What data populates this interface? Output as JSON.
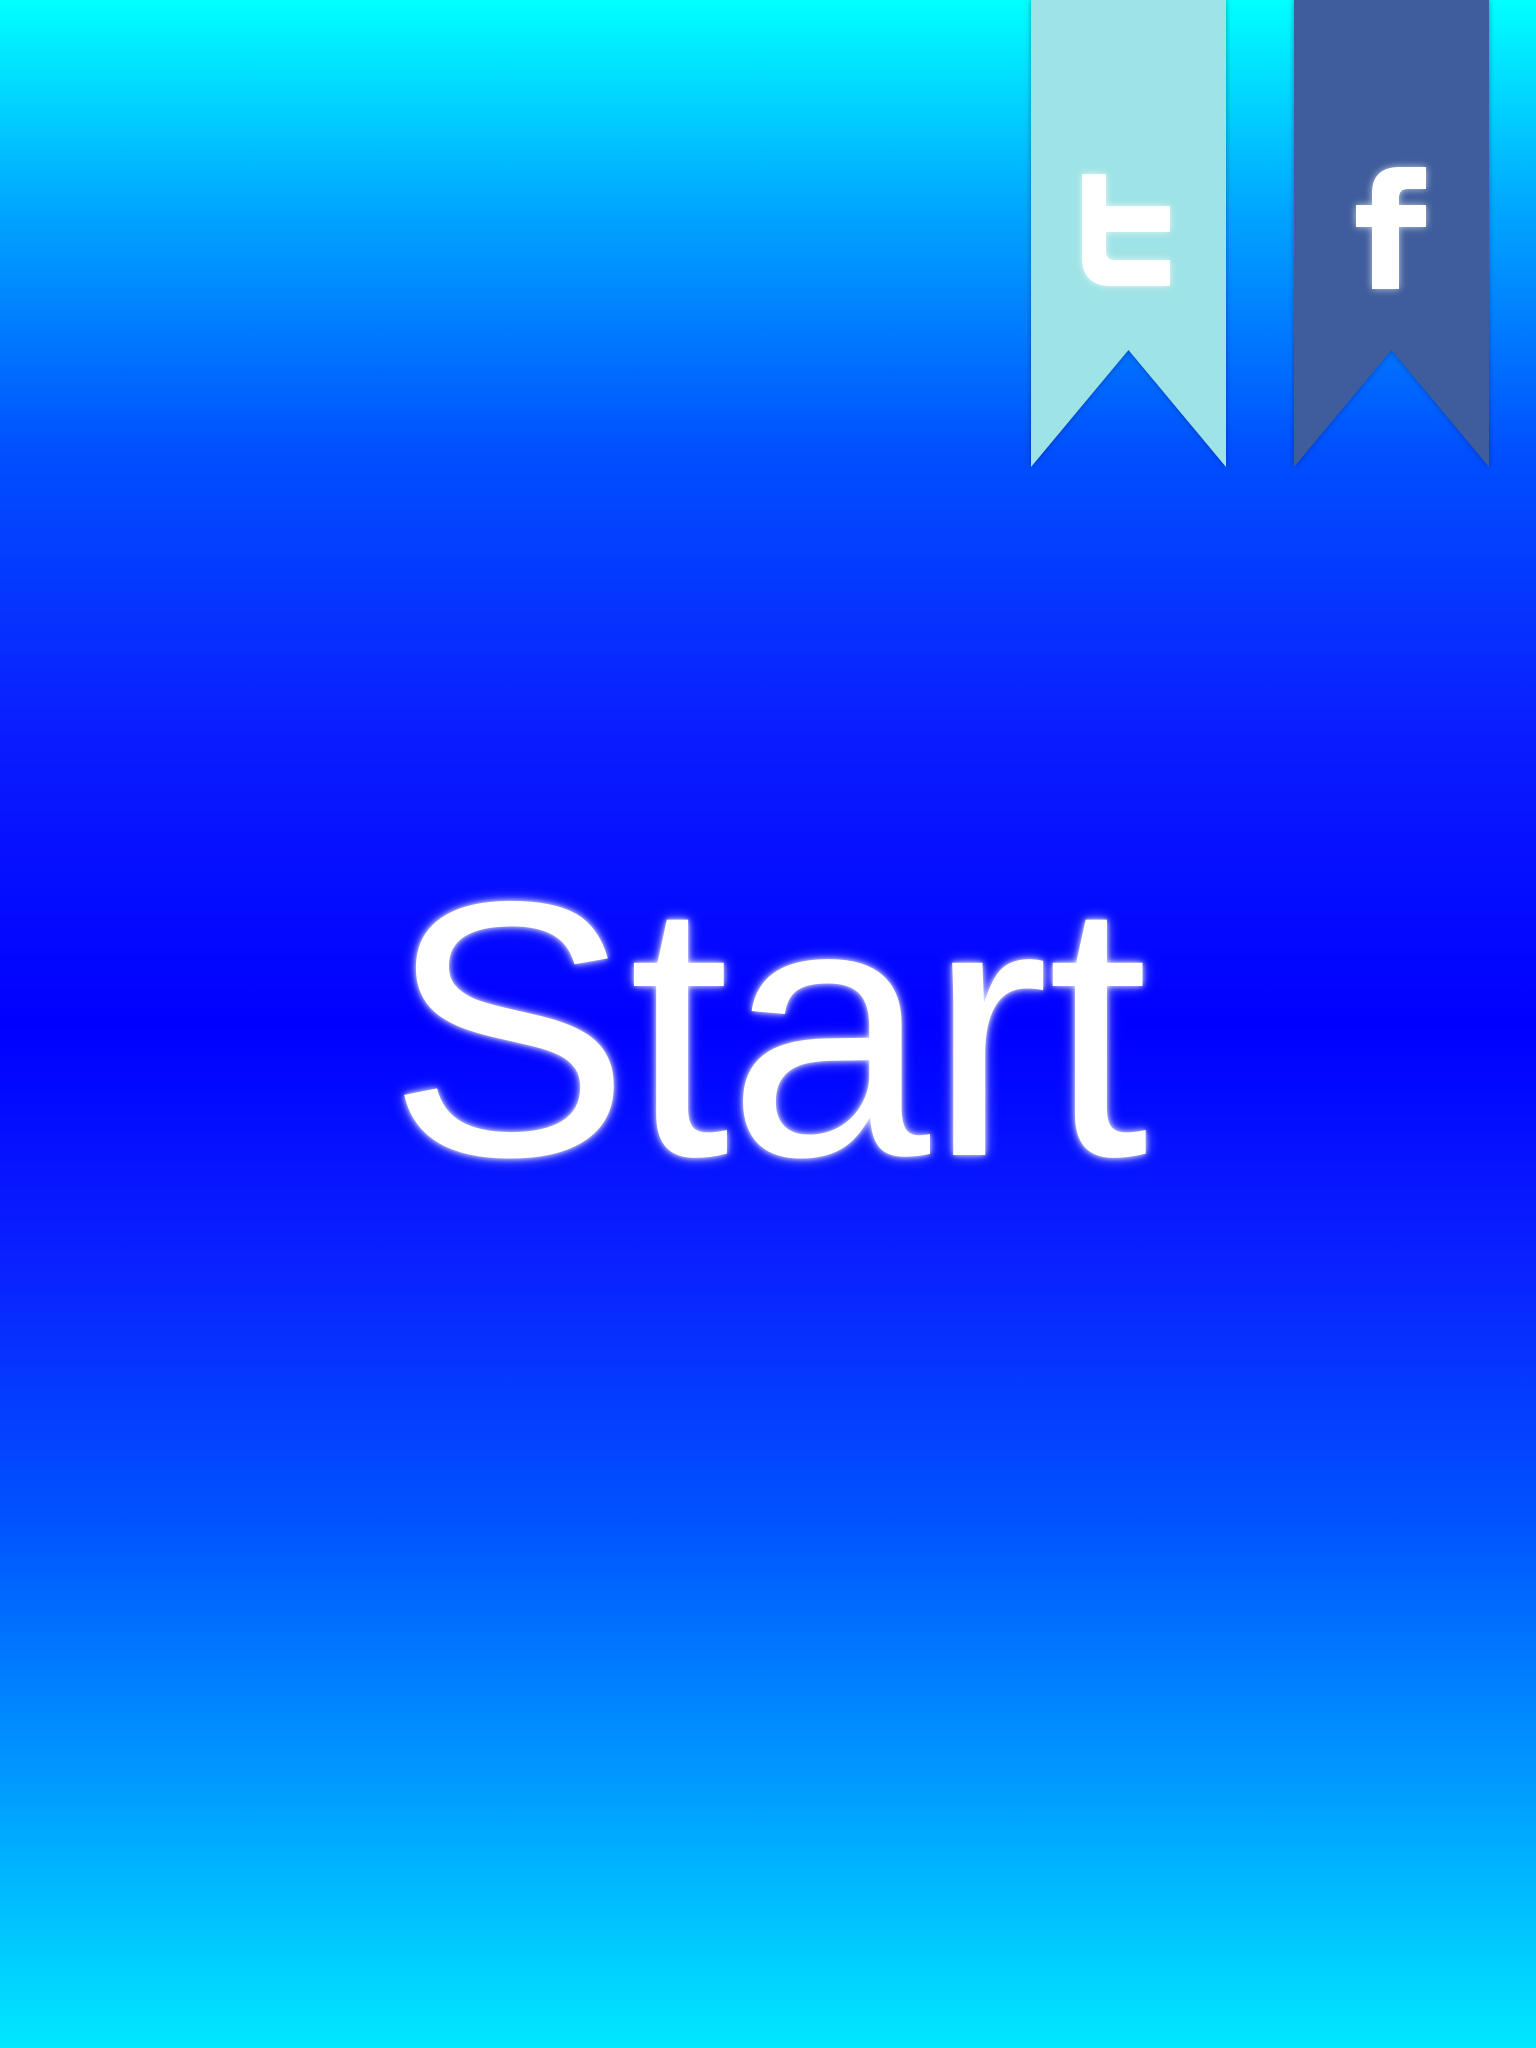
{
  "start": {
    "label": "Start"
  },
  "share": {
    "twitter": {
      "icon": "twitter-icon",
      "color": "#9ee3e6"
    },
    "facebook": {
      "icon": "facebook-icon",
      "color": "#3f5d9c"
    }
  },
  "theme": {
    "gradient_top": "#00ffff",
    "gradient_middle": "#0000ff",
    "gradient_bottom": "#00e8ff",
    "text_color": "#ffffff"
  }
}
